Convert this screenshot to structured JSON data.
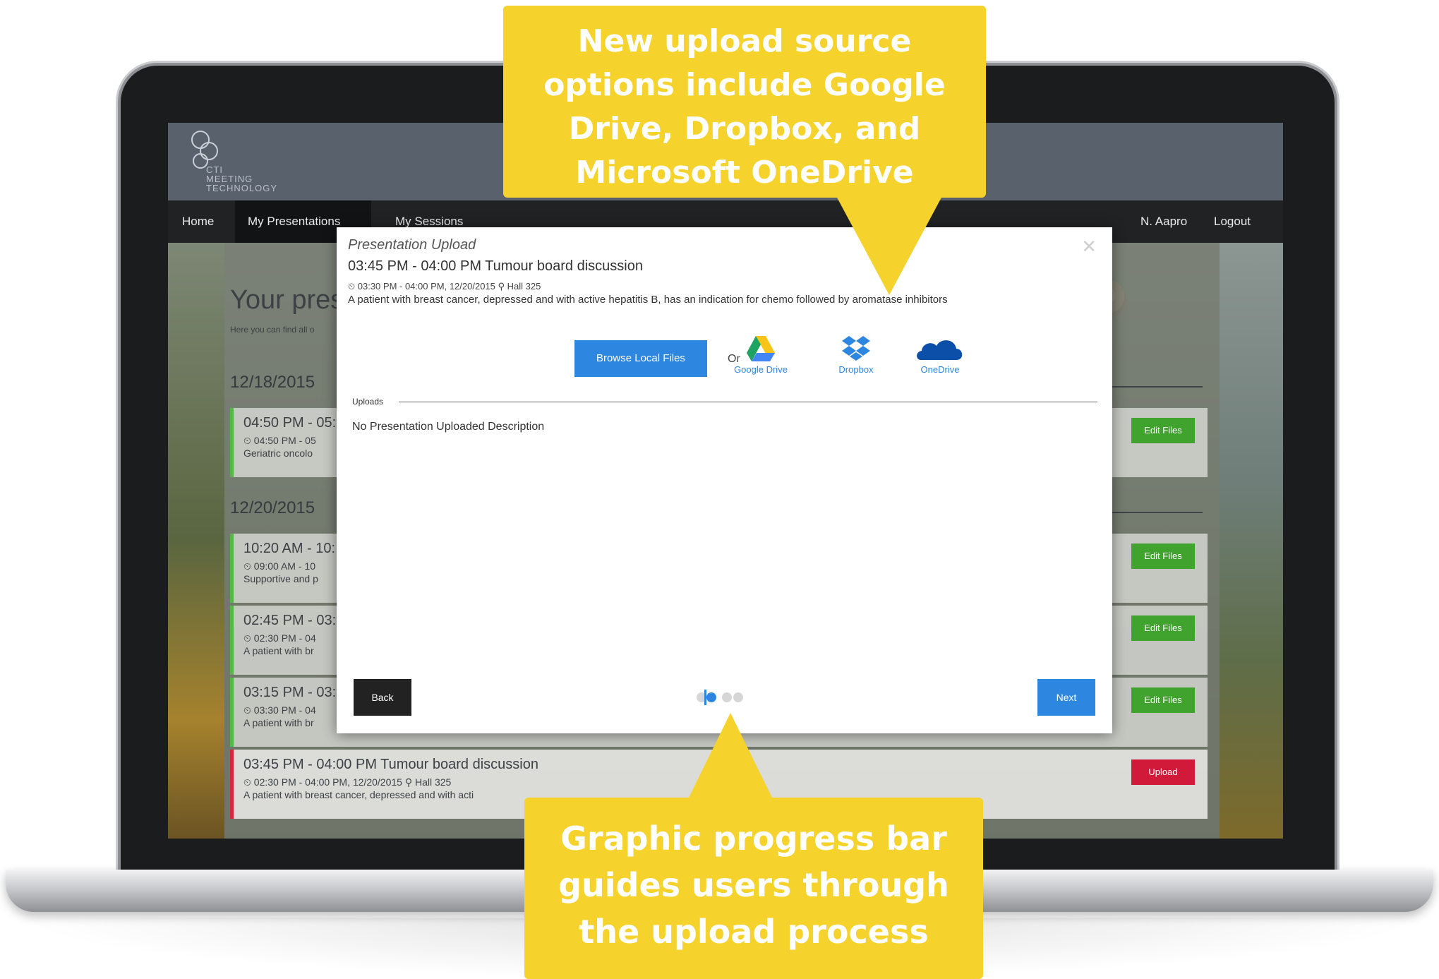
{
  "callouts": {
    "top": "New upload source options include Google Drive, Dropbox, and Microsoft OneDrive",
    "bottom": "Graphic progress bar guides users through the upload process"
  },
  "app": {
    "logo_text": "CTI\nMEETING\nTECHNOLOGY",
    "nav": {
      "home": "Home",
      "my_presentations": "My Presentations",
      "my_sessions": "My Sessions",
      "user_name": "N. Aapro",
      "logout": "Logout"
    },
    "page_title": "Your pres",
    "page_subtitle": "Here you can find all o",
    "dates": [
      "12/18/2015",
      "12/20/2015"
    ],
    "cards": [
      {
        "time": "04:50 PM - 05:",
        "meta": "⏲ 04:50 PM - 05",
        "desc": "Geriatric oncolo",
        "button": "Edit Files"
      },
      {
        "time": "10:20 AM - 10:",
        "meta": "⏲ 09:00 AM - 10",
        "desc": "Supportive and p",
        "button": "Edit Files"
      },
      {
        "time": "02:45 PM - 03:",
        "meta": "⏲ 02:30 PM - 04",
        "desc": "A patient with br",
        "button": "Edit Files"
      },
      {
        "time": "03:15 PM - 03:",
        "meta": "⏲ 03:30 PM - 04",
        "desc": "A patient with br",
        "button": "Edit Files"
      },
      {
        "time": "03:45 PM - 04:00 PM Tumour board discussion",
        "meta": "⏲ 02:30 PM - 04:00 PM, 12/20/2015     ⚲ Hall 325",
        "desc": "A patient with breast cancer, depressed and with acti",
        "button": "Upload"
      }
    ]
  },
  "modal": {
    "kicker": "Presentation Upload",
    "title": "03:45 PM - 04:00 PM  Tumour board discussion",
    "meta": "⏲ 03:30 PM - 04:00 PM, 12/20/2015     ⚲ Hall 325",
    "description": "A patient with breast cancer, depressed and with active hepatitis B, has an indication for chemo followed by aromatase inhibitors",
    "browse_label": "Browse Local Files",
    "or_label": "Or",
    "sources": {
      "google_drive": "Google Drive",
      "dropbox": "Dropbox",
      "onedrive": "OneDrive"
    },
    "uploads_label": "Uploads",
    "no_upload_text": "No Presentation Uploaded Description",
    "back_label": "Back",
    "next_label": "Next",
    "progress": {
      "current_step": 1,
      "total_steps": 4
    }
  },
  "colors": {
    "accent": "#2d86e0",
    "callout": "#f5d22c",
    "success": "#3fa32e",
    "danger": "#d11a39"
  }
}
